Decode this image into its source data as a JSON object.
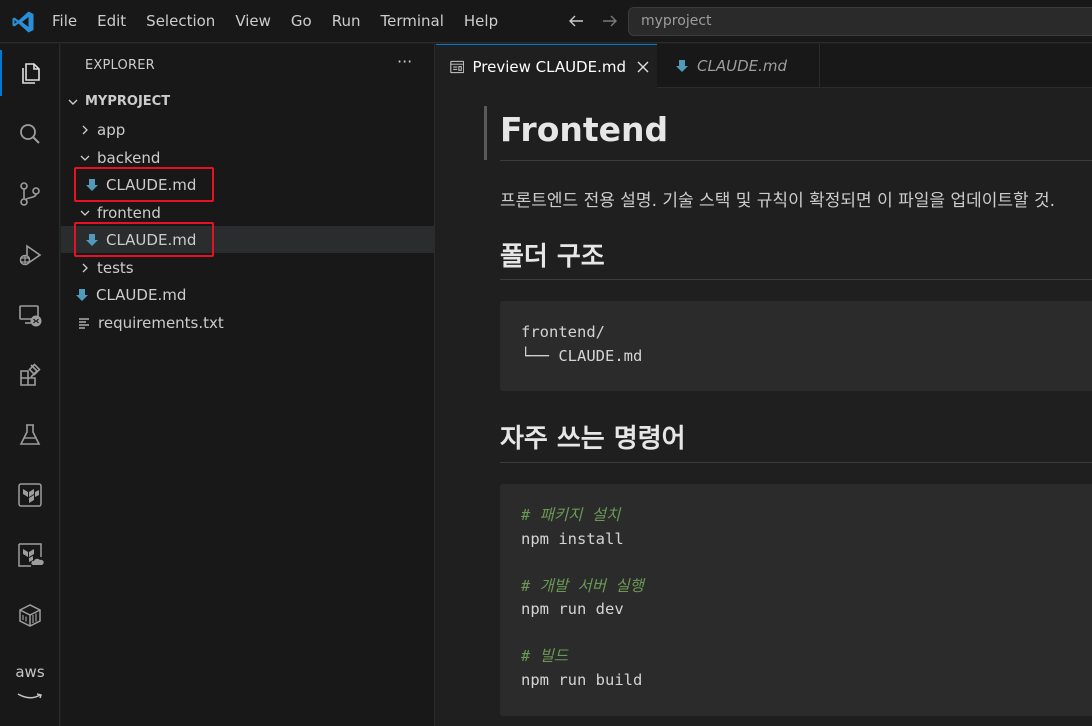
{
  "menu": [
    "File",
    "Edit",
    "Selection",
    "View",
    "Go",
    "Run",
    "Terminal",
    "Help"
  ],
  "search": {
    "value": "myproject"
  },
  "activity_icons": [
    "explorer-icon",
    "search-icon",
    "source-control-icon",
    "run-debug-icon",
    "remote-explorer-icon",
    "extensions-icon",
    "testing-icon",
    "terraform-icon",
    "terraform-cloud-icon",
    "containers-icon",
    "aws-icon"
  ],
  "aws_label": "aws",
  "sidebar": {
    "title": "EXPLORER",
    "more": "···",
    "root": "MYPROJECT",
    "items": [
      {
        "label": "app",
        "type": "folder",
        "expanded": false
      },
      {
        "label": "backend",
        "type": "folder",
        "expanded": true
      },
      {
        "label": "CLAUDE.md",
        "type": "markdown"
      },
      {
        "label": "frontend",
        "type": "folder",
        "expanded": true
      },
      {
        "label": "CLAUDE.md",
        "type": "markdown"
      },
      {
        "label": "tests",
        "type": "folder",
        "expanded": false
      },
      {
        "label": "CLAUDE.md",
        "type": "markdown"
      },
      {
        "label": "requirements.txt",
        "type": "text"
      }
    ]
  },
  "tabs": [
    {
      "label": "Preview CLAUDE.md",
      "active": true
    },
    {
      "label": "CLAUDE.md",
      "active": false
    }
  ],
  "preview": {
    "h1": "Frontend",
    "paragraph": "프론트엔드 전용 설명. 기술 스택 및 규칙이 확정되면 이 파일을 업데이트할 것.",
    "section1": "폴더 구조",
    "code1": [
      "frontend/",
      "└── CLAUDE.md"
    ],
    "section2": "자주 쓰는 명령어",
    "code2": [
      {
        "text": "# 패키지 설치",
        "comment": true
      },
      {
        "text": "npm install",
        "comment": false
      },
      {
        "text": "",
        "comment": false
      },
      {
        "text": "# 개발 서버 실행",
        "comment": true
      },
      {
        "text": "npm run dev",
        "comment": false
      },
      {
        "text": "",
        "comment": false
      },
      {
        "text": "# 빌드",
        "comment": true
      },
      {
        "text": "npm run build",
        "comment": false
      }
    ]
  },
  "colors": {
    "accent": "#0078d4",
    "highlight": "#e81123",
    "markdown_icon": "#519aba",
    "comment": "#6a9955"
  }
}
